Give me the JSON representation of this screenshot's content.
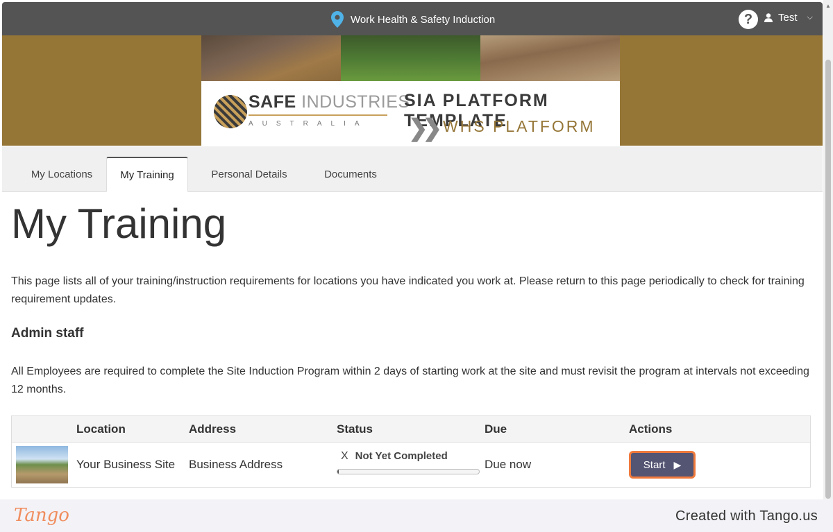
{
  "header": {
    "title": "Work Health & Safety Induction",
    "user": "Test",
    "help": "?"
  },
  "banner": {
    "brand_bold": "SAFE",
    "brand_light": " INDUSTRIES",
    "brand_sub": "AUSTRALIA",
    "template_title": "SIA PLATFORM TEMPLATE",
    "template_sub": "WHS PLATFORM"
  },
  "tabs": [
    {
      "label": "My Locations"
    },
    {
      "label": "My Training",
      "active": true
    },
    {
      "label": "Personal Details"
    },
    {
      "label": "Documents"
    }
  ],
  "page": {
    "title": "My Training",
    "intro": "This page lists all of your training/instruction requirements for locations you have indicated you work at. Please return to this page periodically to check for training requirement updates.",
    "section_title": "Admin staff",
    "section_text": "All Employees are required to complete the Site Induction Program within 2 days of starting work at the site and must revisit the program at intervals not exceeding 12 months."
  },
  "table": {
    "headers": {
      "location": "Location",
      "address": "Address",
      "status": "Status",
      "due": "Due",
      "actions": "Actions"
    },
    "rows": [
      {
        "location": "Your Business Site",
        "address": "Business Address",
        "status_mark": "X",
        "status": "Not Yet Completed",
        "progress": 0.01,
        "due": "Due now",
        "action": "Start"
      }
    ]
  },
  "footer": {
    "brand": "Tango",
    "created": "Created with Tango.us"
  },
  "colors": {
    "topbar": "#545454",
    "banner": "#957637",
    "button": "#545473",
    "button_border": "#f07a3c",
    "tango": "#f08d5e"
  }
}
